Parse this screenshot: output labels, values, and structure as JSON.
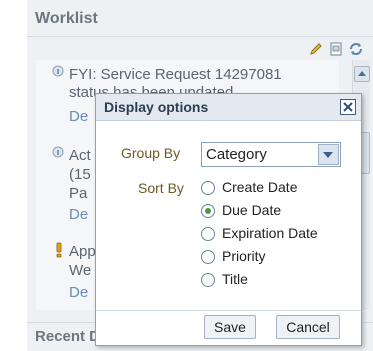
{
  "panel": {
    "title": "Worklist",
    "section2_title": "Recent D"
  },
  "toolbar": {
    "icons": [
      "pencil-icon",
      "page-icon",
      "refresh-icon"
    ]
  },
  "background_items": [
    {
      "line1": "FYI: Service Request 14297081",
      "line2": "status has been updated",
      "link": "De",
      "icon": "info-icon"
    },
    {
      "line1": "Act",
      "line2": "(15",
      "line3": "Pa",
      "link": "De",
      "icon": "info-icon"
    },
    {
      "line1": "App",
      "line2": "We",
      "link": "De",
      "icon": "exclamation-icon"
    }
  ],
  "dialog": {
    "title": "Display options",
    "group_by_label": "Group By",
    "group_by_value": "Category",
    "sort_by_label": "Sort By",
    "sort_options": [
      "Create Date",
      "Due Date",
      "Expiration Date",
      "Priority",
      "Title"
    ],
    "sort_selected": "Due Date",
    "save_label": "Save",
    "cancel_label": "Cancel"
  }
}
